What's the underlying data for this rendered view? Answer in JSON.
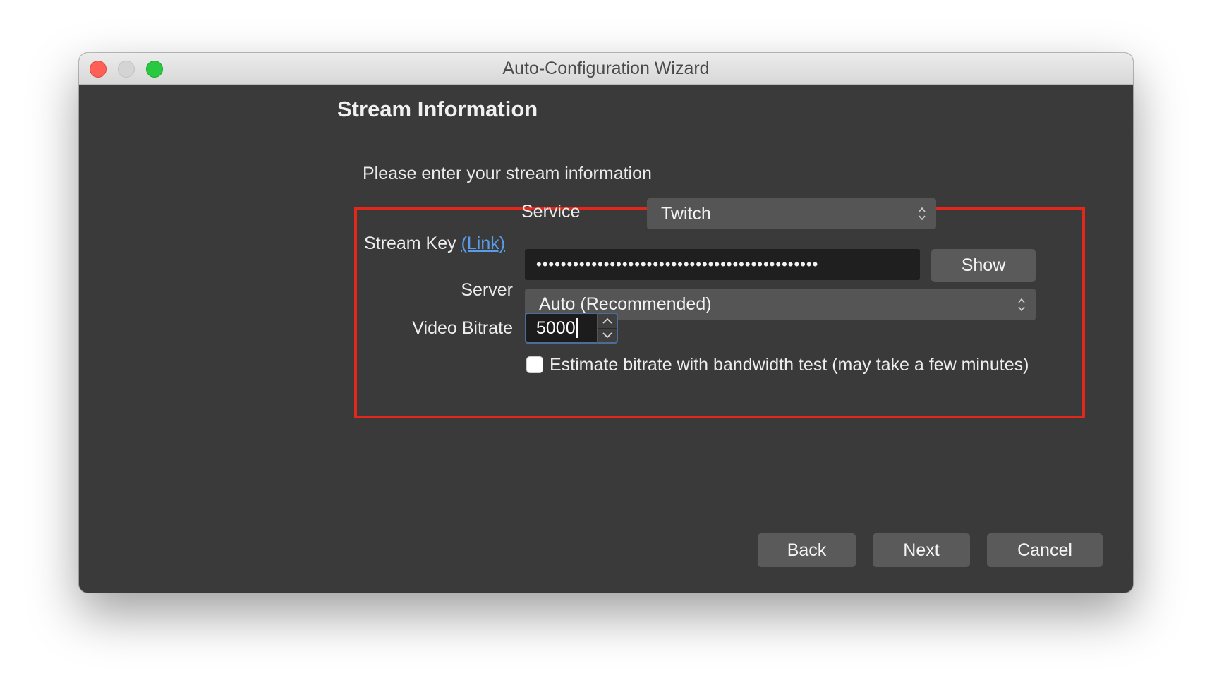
{
  "window": {
    "title": "Auto-Configuration Wizard"
  },
  "page": {
    "title": "Stream Information",
    "subtitle": "Please enter your stream information"
  },
  "form": {
    "service": {
      "label": "Service",
      "value": "Twitch"
    },
    "stream_key": {
      "label": "Stream Key",
      "link_text": "(Link)",
      "masked_value": "••••••••••••••••••••••••••••••••••••••••••••••",
      "show_label": "Show"
    },
    "server": {
      "label": "Server",
      "value": "Auto (Recommended)"
    },
    "video_bitrate": {
      "label": "Video Bitrate",
      "value": "5000"
    },
    "bandwidth_test": {
      "label": "Estimate bitrate with bandwidth test (may take a few minutes)",
      "checked": false
    }
  },
  "footer": {
    "back_label": "Back",
    "next_label": "Next",
    "cancel_label": "Cancel"
  },
  "colors": {
    "highlight_border": "#e3281b",
    "link": "#5b9ce8",
    "window_background": "#3a3a3a"
  },
  "icons": {
    "combo_stepper": "chevron-up-down-icon",
    "spin_up": "chevron-up-icon",
    "spin_down": "chevron-down-icon"
  }
}
